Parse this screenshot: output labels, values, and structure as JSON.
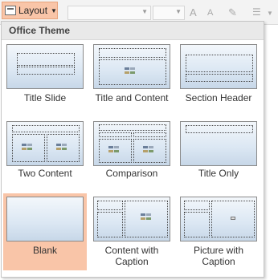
{
  "ribbon": {
    "layout_button_label": "Layout",
    "font_glyphs": [
      "A",
      "A"
    ]
  },
  "panel": {
    "header": "Office Theme",
    "layouts": [
      {
        "label": "Title Slide"
      },
      {
        "label": "Title and Content"
      },
      {
        "label": "Section Header"
      },
      {
        "label": "Two Content"
      },
      {
        "label": "Comparison"
      },
      {
        "label": "Title Only"
      },
      {
        "label": "Blank",
        "selected": true
      },
      {
        "label": "Content with Caption"
      },
      {
        "label": "Picture with Caption"
      }
    ]
  }
}
